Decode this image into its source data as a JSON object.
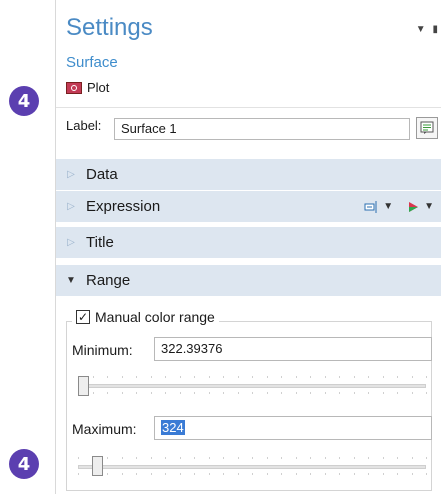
{
  "badges": {
    "top": "4",
    "bottom": "4"
  },
  "settings": {
    "title": "Settings",
    "subtitle": "Surface",
    "plot_label": "Plot",
    "label_field": {
      "label": "Label:",
      "value": "Surface 1"
    }
  },
  "sections": [
    {
      "label": "Data",
      "expanded": false
    },
    {
      "label": "Expression",
      "expanded": false
    },
    {
      "label": "Title",
      "expanded": false
    },
    {
      "label": "Range",
      "expanded": true
    }
  ],
  "range": {
    "manual_color_range": {
      "label": "Manual color range",
      "checked": true
    },
    "minimum": {
      "label": "Minimum:",
      "value": "322.39376",
      "slider_fraction": 0.0
    },
    "maximum": {
      "label": "Maximum:",
      "value": "324",
      "slider_fraction": 0.05
    }
  },
  "colors": {
    "badge": "#5b3fb0",
    "title": "#4a8ac4",
    "section_bg": "#dde6f0"
  }
}
